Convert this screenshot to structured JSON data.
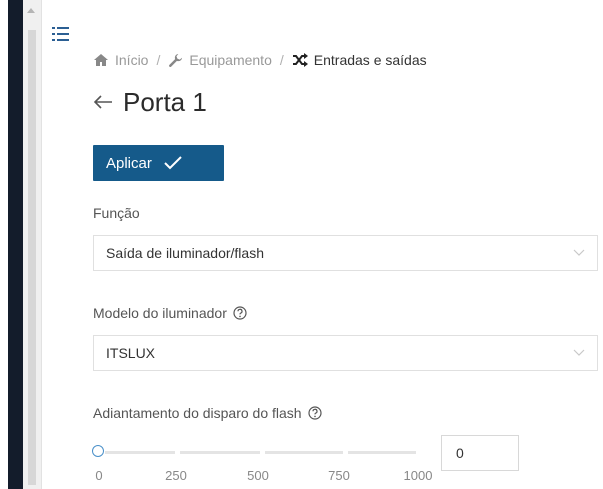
{
  "breadcrumb": {
    "items": [
      {
        "label": "Início",
        "icon": "home-icon"
      },
      {
        "label": "Equipamento",
        "icon": "wrench-icon"
      },
      {
        "label": "Entradas e saídas",
        "icon": "shuffle-icon"
      }
    ],
    "separator": "/"
  },
  "page": {
    "title": "Porta 1"
  },
  "actions": {
    "apply_label": "Aplicar"
  },
  "fields": {
    "function": {
      "label": "Função",
      "value": "Saída de iluminador/flash"
    },
    "illuminator_model": {
      "label": "Modelo do iluminador",
      "value": "ITSLUX"
    },
    "flash_advance": {
      "label": "Adiantamento do disparo do flash",
      "value": "0",
      "slider_fraction": 0,
      "ticks": [
        "0",
        "250",
        "500",
        "750",
        "1000"
      ]
    }
  },
  "colors": {
    "primary": "#155a8a",
    "nav_dark": "#131c2b",
    "accent": "#2b5f93"
  }
}
